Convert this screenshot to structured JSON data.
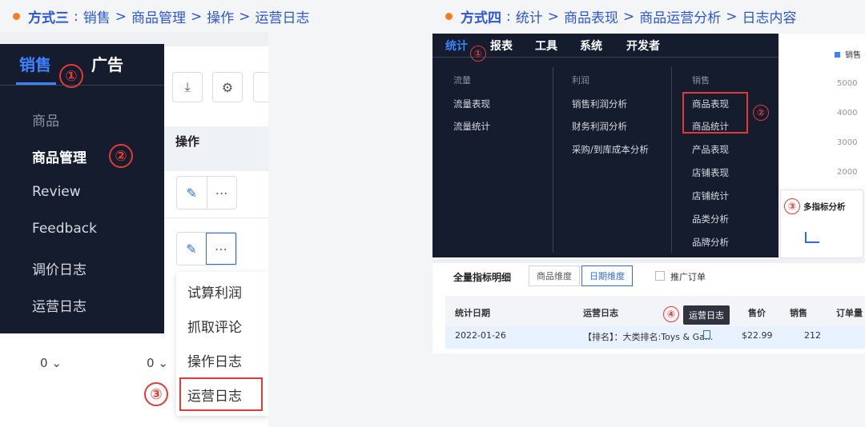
{
  "left_heading": {
    "method": "方式三",
    "colon": ":",
    "path": [
      "销售",
      "商品管理",
      "操作",
      "运营日志"
    ],
    "sep": ">"
  },
  "right_heading": {
    "method": "方式四",
    "colon": ":",
    "path": [
      "统计",
      "商品表现",
      "商品运营分析",
      "日志内容"
    ],
    "sep": ">"
  },
  "left": {
    "tabs": {
      "sales": "销售",
      "ads": "广告"
    },
    "menu": [
      "商品",
      "商品管理",
      "Review",
      "Feedback",
      "调价日志",
      "运营日志"
    ],
    "column_header": "操作",
    "dropdown": [
      "试算利润",
      "抓取评论",
      "操作日志",
      "运营日志"
    ],
    "steps": [
      "①",
      "②",
      "③"
    ],
    "zero_values": [
      "0",
      "0"
    ],
    "chevron": "⌄"
  },
  "right": {
    "nav": [
      "统计",
      "报表",
      "工具",
      "系统",
      "开发者"
    ],
    "columns": [
      {
        "title": "流量",
        "items": [
          "流量表现",
          "流量统计"
        ]
      },
      {
        "title": "利润",
        "items": [
          "销售利润分析",
          "财务利润分析",
          "采购/到库成本分析"
        ]
      },
      {
        "title": "销售",
        "items": [
          "商品表现",
          "商品统计",
          "产品表现",
          "店铺表现",
          "店铺统计",
          "品类分析",
          "品牌分析"
        ]
      }
    ],
    "steps": [
      "①",
      "②",
      "③",
      "④"
    ],
    "y_ticks": [
      "5000",
      "4000",
      "3000",
      "2000"
    ],
    "legend": "销售",
    "popup_label": "多指标分析",
    "section_title": "全量指标明细",
    "segments": [
      "商品维度",
      "日期维度"
    ],
    "checkbox_label": "推广订单",
    "table_headers": [
      "统计日期",
      "运营日志",
      "售价",
      "销售",
      "订单量"
    ],
    "tooltip": "运营日志",
    "row": {
      "date": "2022-01-26",
      "log": "【排名】：大类排名:Toys & Ga...",
      "price": "$22.99",
      "sales": "212"
    }
  }
}
